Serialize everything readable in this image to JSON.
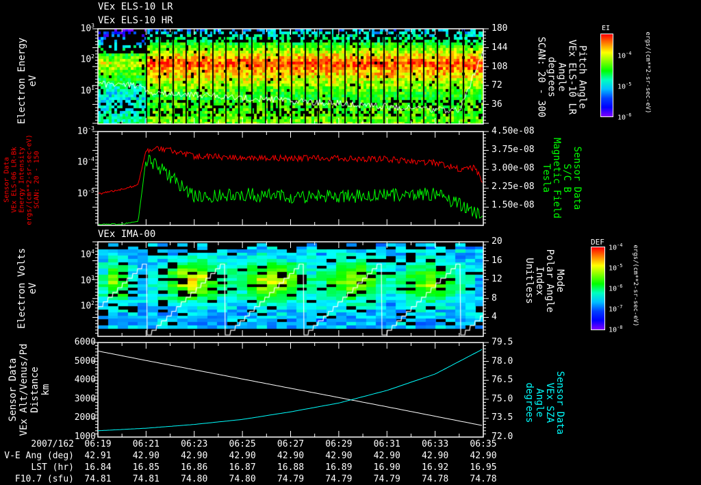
{
  "headers": {
    "panel1_line1": "VEx ELS-10 LR",
    "panel1_line2": "VEx ELS-10 HR",
    "panel3": "VEx IMA-00"
  },
  "colors": {
    "background": "#000000",
    "axes": "#ffffff",
    "red_series": "#ff0000",
    "green_series": "#00ff00",
    "cyan_series": "#00ffff",
    "white_series": "#ffffff"
  },
  "colorbars": {
    "ei": {
      "title": "EI",
      "tick_base": "10",
      "tick_exps": [
        "-4",
        "-5",
        "-6"
      ],
      "units": "ergs/(cm**2-sr-sec-eV)"
    },
    "def": {
      "title": "DEF",
      "tick_base": "10",
      "tick_exps": [
        "-4",
        "-5",
        "-6",
        "-7",
        "-8"
      ],
      "units": "ergs/(cm**2-sr-sec-eV)"
    }
  },
  "x_axis": {
    "ticks": [
      "06:19",
      "06:21",
      "06:23",
      "06:25",
      "06:27",
      "06:29",
      "06:31",
      "06:33",
      "06:35"
    ],
    "rows": [
      {
        "label": "2007/162",
        "values": [
          "06:19",
          "06:21",
          "06:23",
          "06:25",
          "06:27",
          "06:29",
          "06:31",
          "06:33",
          "06:35"
        ]
      },
      {
        "label": "V-E Ang (deg)",
        "values": [
          "42.91",
          "42.90",
          "42.90",
          "42.90",
          "42.90",
          "42.90",
          "42.90",
          "42.90",
          "42.90"
        ]
      },
      {
        "label": "LST (hr)",
        "values": [
          "16.84",
          "16.85",
          "16.86",
          "16.87",
          "16.88",
          "16.89",
          "16.90",
          "16.92",
          "16.95"
        ]
      },
      {
        "label": "F10.7 (sfu)",
        "values": [
          "74.81",
          "74.81",
          "74.80",
          "74.80",
          "74.79",
          "74.79",
          "74.79",
          "74.78",
          "74.78"
        ]
      }
    ]
  },
  "chart_data": [
    {
      "type": "heatmap",
      "ylabel": [
        "Electron Energy",
        "eV"
      ],
      "y_scale": "log",
      "ylim": [
        1,
        1000
      ],
      "y_ticks": [
        {
          "base": "10",
          "exp": "3"
        },
        {
          "base": "10",
          "exp": "2"
        },
        {
          "base": "10",
          "exp": "1"
        }
      ],
      "y2label": [
        "Pitch Angle",
        "VEx ELS-10 LR",
        "Angle",
        "degrees",
        "SCAN: 20 - 300"
      ],
      "y2_ticks": [
        "180",
        "144",
        "108",
        "72",
        "36"
      ],
      "y2lim": [
        0,
        180
      ],
      "colorbar": "ei",
      "peak_energy_eV": 100,
      "onset_time": "06:21",
      "overlay_line": {
        "color": "#ffffff",
        "approx_degrees": [
          60,
          70,
          55,
          55,
          50,
          50,
          52,
          50,
          170
        ]
      }
    },
    {
      "type": "line",
      "ylabel": [
        "Sensor Data",
        "VEx ELS-06 LR-Bk",
        "Energy Intensity",
        "ergs/(cm**2-sr-sec-eV)",
        "SCAN: 20 - 150"
      ],
      "y_scale": "log",
      "ylim": [
        1e-06,
        0.001
      ],
      "y_ticks": [
        {
          "base": "10",
          "exp": "-3"
        },
        {
          "base": "10",
          "exp": "-4"
        },
        {
          "base": "10",
          "exp": "-5"
        }
      ],
      "y2label": [
        "Sensor Data",
        "S/C B",
        "Magnetic Field",
        "Tesla"
      ],
      "y2_ticks": [
        "4.50e-08",
        "3.75e-08",
        "3.00e-08",
        "2.25e-08",
        "1.50e-08"
      ],
      "y2lim": [
        7.5e-09,
        4.5e-08
      ],
      "x": [
        "06:19",
        "06:20",
        "06:20:40",
        "06:21",
        "06:21:30",
        "06:22",
        "06:23",
        "06:25",
        "06:27",
        "06:29",
        "06:31",
        "06:33",
        "06:34",
        "06:34:40",
        "06:35"
      ],
      "series": [
        {
          "axis": "left",
          "color": "#ff0000",
          "values": [
            1e-05,
            1.4e-05,
            2e-05,
            0.00025,
            0.0003,
            0.00025,
            0.00016,
            0.00015,
            0.00014,
            0.00014,
            0.00013,
            0.0001,
            6.5e-05,
            7e-05,
            2e-05
          ]
        },
        {
          "axis": "right",
          "color": "#00ff00",
          "values": [
            8e-09,
            8e-09,
            9e-09,
            3.4e-08,
            3.1e-08,
            2.7e-08,
            1.9e-08,
            2e-08,
            1.9e-08,
            1.9e-08,
            1.95e-08,
            2e-08,
            1.6e-08,
            1.3e-08,
            1.2e-08
          ]
        }
      ]
    },
    {
      "type": "heatmap",
      "ylabel": [
        "Electron Volts",
        "eV"
      ],
      "y_scale": "log",
      "ylim": [
        6,
        30000
      ],
      "y_ticks": [
        {
          "base": "10",
          "exp": "4"
        },
        {
          "base": "10",
          "exp": "3"
        },
        {
          "base": "10",
          "exp": "2"
        }
      ],
      "y2label": [
        "Mode",
        "Polar Angle",
        "Index",
        "Unitless"
      ],
      "y2_ticks": [
        "20",
        "16",
        "12",
        "8",
        "4"
      ],
      "y2lim": [
        0,
        20
      ],
      "colorbar": "def",
      "overlay_line": {
        "color": "#ffffff",
        "pattern": "staircase 0-15, period ~3.2 min"
      }
    },
    {
      "type": "line",
      "ylabel": [
        "Sensor Data",
        "VEx Alt/Venus/Pd",
        "Distance",
        "km"
      ],
      "ylim": [
        1000,
        6000
      ],
      "y_ticks": [
        "6000",
        "5000",
        "4000",
        "3000",
        "2000",
        "1000"
      ],
      "y2label": [
        "Sensor Data",
        "VEx SZA",
        "Angle",
        "degrees"
      ],
      "y2_ticks": [
        "79.5",
        "78.0",
        "76.5",
        "75.0",
        "73.5",
        "72.0"
      ],
      "y2lim": [
        72.0,
        79.5
      ],
      "x": [
        "06:19",
        "06:21",
        "06:23",
        "06:25",
        "06:27",
        "06:29",
        "06:31",
        "06:33",
        "06:35"
      ],
      "series": [
        {
          "axis": "left",
          "color": "#ffffff",
          "values": [
            5550,
            5050,
            4560,
            4070,
            3580,
            3090,
            2600,
            2100,
            1600
          ]
        },
        {
          "axis": "right",
          "color": "#00ffff",
          "values": [
            72.5,
            72.7,
            73.0,
            73.4,
            74.0,
            74.7,
            75.7,
            77.0,
            79.0
          ]
        }
      ]
    }
  ]
}
